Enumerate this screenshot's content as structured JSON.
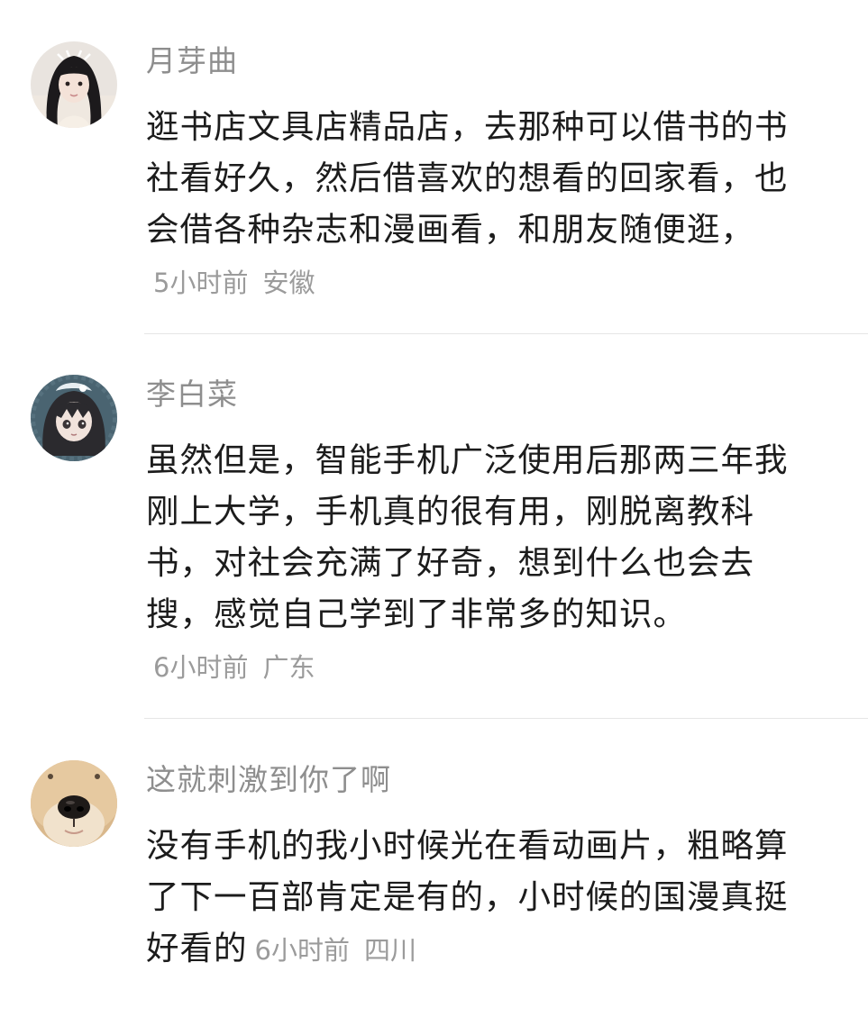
{
  "comments": [
    {
      "username": "月芽曲",
      "text": "逛书店文具店精品店，去那种可以借书的书社看好久，然后借喜欢的想看的回家看，也会借各种杂志和漫画看，和朋友随便逛，",
      "time": "5小时前",
      "location": "安徽",
      "avatar": "avatar-girl-photo-icon"
    },
    {
      "username": "李白菜",
      "text": "虽然但是，智能手机广泛使用后那两三年我刚上大学，手机真的很有用，刚脱离教科书，对社会充满了好奇，想到什么也会去搜，感觉自己学到了非常多的知识。",
      "time": "6小时前",
      "location": "广东",
      "avatar": "avatar-anime-girl-icon"
    },
    {
      "username": "这就刺激到你了啊",
      "text": "没有手机的我小时候光在看动画片，粗略算了下一百部肯定是有的，小时候的国漫真挺好看的",
      "time": "6小时前",
      "location": "四川",
      "avatar": "avatar-dog-nose-icon"
    }
  ],
  "colors": {
    "username": "#8e8e8e",
    "text": "#1c1c1c",
    "meta": "#9b9b9b",
    "divider": "#e6e6e6",
    "background": "#ffffff"
  }
}
